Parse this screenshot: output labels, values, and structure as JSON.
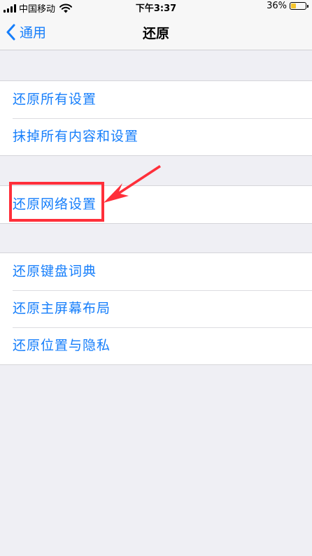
{
  "status": {
    "carrier": "中国移动",
    "time": "下午3:37",
    "battery_text": "36%",
    "battery_level": 0.36
  },
  "nav": {
    "back_label": "通用",
    "title": "还原"
  },
  "groups": [
    {
      "items": [
        "还原所有设置",
        "抹掉所有内容和设置"
      ]
    },
    {
      "items": [
        "还原网络设置"
      ]
    },
    {
      "items": [
        "还原键盘词典",
        "还原主屏幕布局",
        "还原位置与隐私"
      ]
    }
  ],
  "colors": {
    "accent": "#157efb",
    "annotation": "#ff2f3a",
    "battery": "#f5c52c",
    "background": "#efeff4"
  },
  "icons": {
    "back": "chevron-left-icon",
    "wifi": "wifi-icon",
    "signal": "signal-icon",
    "battery": "battery-icon",
    "annotation": "arrow-icon"
  }
}
